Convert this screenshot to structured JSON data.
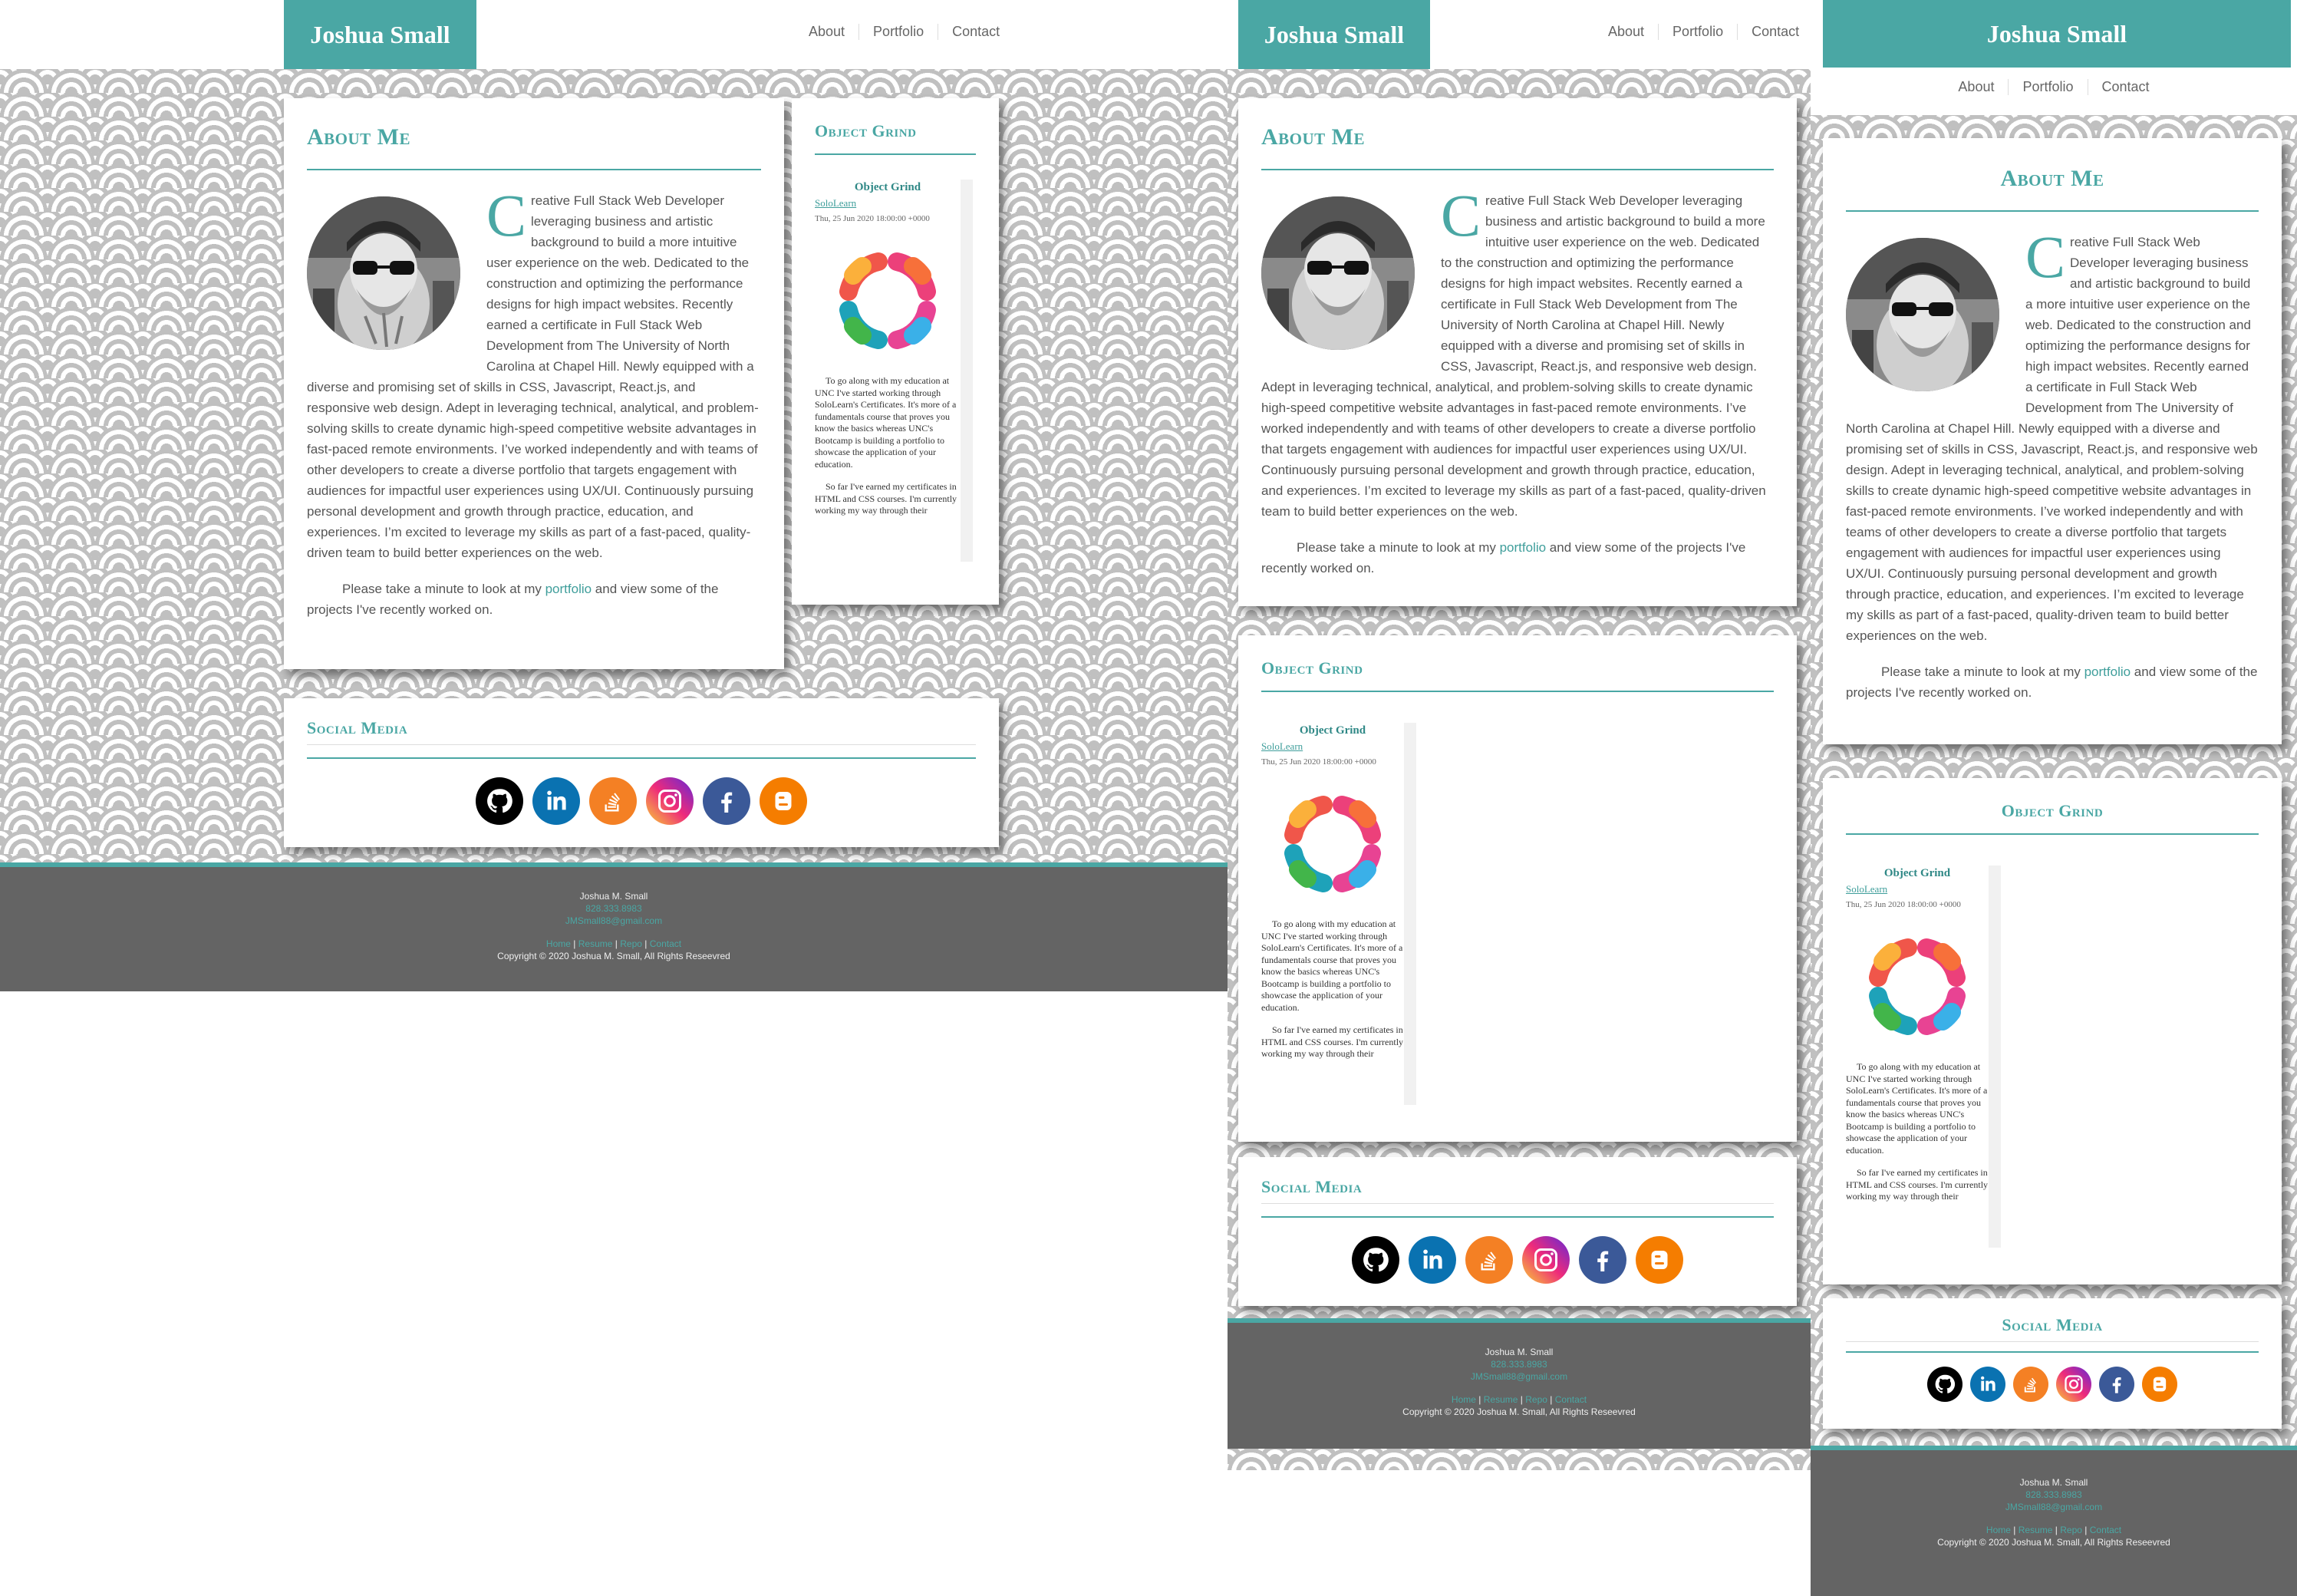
{
  "brand": "Joshua Small",
  "nav": {
    "about": "About",
    "portfolio": "Portfolio",
    "contact": "Contact"
  },
  "about": {
    "title": "About Me",
    "dropcap": "C",
    "body": "reative Full Stack Web Developer leveraging business and artistic background to build a more intuitive user experience on the web. Dedicated to the construction and optimizing the performance designs for high impact websites. Recently earned a certificate in Full Stack Web Development from The University of North Carolina at Chapel Hill. Newly equipped with a diverse and promising set of skills in CSS, Javascript, React.js, and responsive web design. Adept in leveraging technical, analytical, and problem-solving skills to create dynamic high-speed competitive website advantages in fast-paced remote environments. I’ve worked independently and with teams of other developers to create a diverse portfolio that targets engagement with audiences for impactful user experiences using UX/UI. Continuously pursuing personal development and growth through practice, education, and experiences. I’m excited to leverage my skills as part of a fast-paced, quality-driven team to build better experiences on the web.",
    "cta_before": "Please take a minute to look at my ",
    "cta_link": "portfolio",
    "cta_after": " and view some of the projects I've recently worked on."
  },
  "feed": {
    "title": "Object Grind",
    "post_title": "Object Grind",
    "source": "SoloLearn",
    "date": "Thu, 25 Jun 2020 18:00:00 +0000",
    "para1": "To go along with my education at UNC I've started working through SoloLearn's Certificates. It's more of a fundamentals course that proves you know the basics whereas UNC's Bootcamp is building a portfolio to showcase the application of your education.",
    "para2": "So far I've earned my certificates in HTML and CSS courses. I'm currently working my way through their"
  },
  "social": {
    "title": "Social Media",
    "icons": [
      "github-icon",
      "linkedin-icon",
      "stackoverflow-icon",
      "instagram-icon",
      "facebook-icon",
      "blogger-icon"
    ],
    "colors": {
      "github": "#000000",
      "linkedin": "#0a72b1",
      "stackoverflow": "#f48024",
      "facebook": "#3b5998",
      "blogger": "#f57d00"
    }
  },
  "footer": {
    "name": "Joshua M. Small",
    "phone": "828.333.8983",
    "email": "JMSmall88@gmail.com",
    "link_home": "Home",
    "link_resume": "Resume",
    "link_repo": "Repo",
    "link_contact": "Contact",
    "sep": "|",
    "copyright": "Copyright © 2020 Joshua M. Small, All Rights Reseevred"
  },
  "colors": {
    "accent": "#4aa7a4",
    "footer": "#646464"
  }
}
